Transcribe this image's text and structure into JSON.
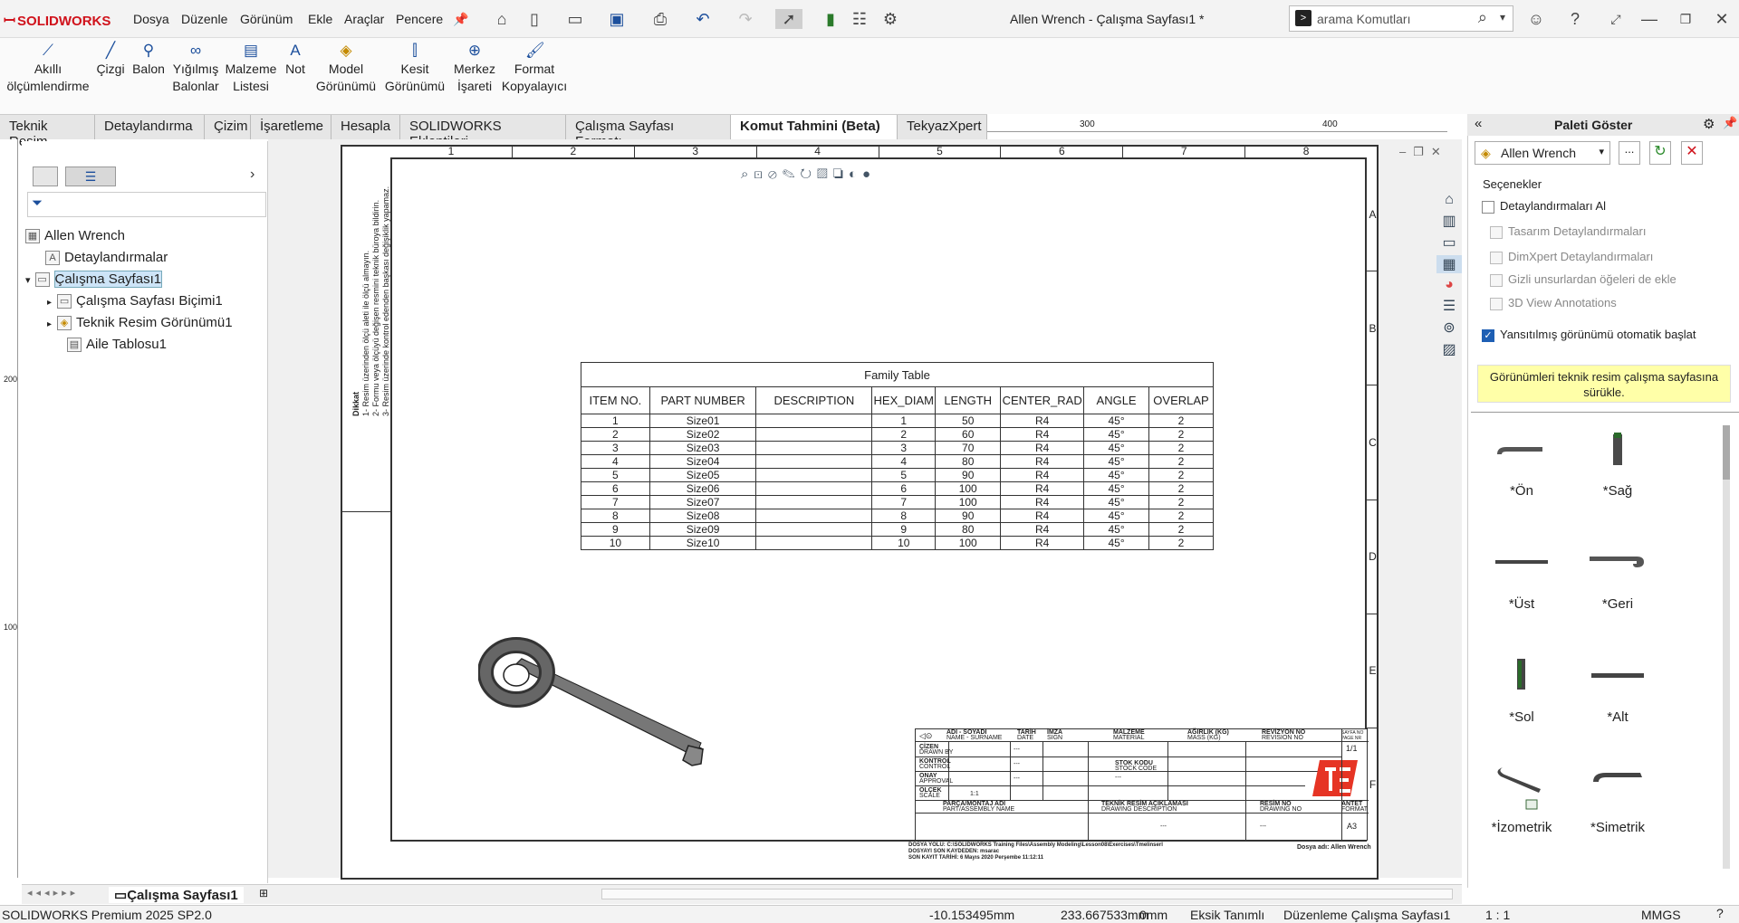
{
  "app": {
    "logo": "SOLIDWORKS",
    "window_title": "Allen Wrench - Çalışma Sayfası1 *",
    "menu": [
      "Dosya",
      "Düzenle",
      "Görünüm",
      "Ekle",
      "Araçlar",
      "Pencere"
    ],
    "search_placeholder": "arama Komutları"
  },
  "ribbon": {
    "buttons": [
      {
        "label1": "Akıllı",
        "label2": "ölçümlendirme",
        "icon": "smart-dimension-icon"
      },
      {
        "label1": "Çizgi",
        "label2": "",
        "icon": "line-icon"
      },
      {
        "label1": "Balon",
        "label2": "",
        "icon": "balloon-icon"
      },
      {
        "label1": "Yığılmış",
        "label2": "Balonlar",
        "icon": "stacked-balloon-icon"
      },
      {
        "label1": "Malzeme",
        "label2": "Listesi",
        "icon": "bom-icon"
      },
      {
        "label1": "Not",
        "label2": "",
        "icon": "note-icon"
      },
      {
        "label1": "Model",
        "label2": "Görünümü",
        "icon": "model-view-icon"
      },
      {
        "label1": "Kesit",
        "label2": "Görünümü",
        "icon": "section-view-icon"
      },
      {
        "label1": "Merkez",
        "label2": "İşareti",
        "icon": "center-mark-icon"
      },
      {
        "label1": "Format",
        "label2": "Kopyalayıcı",
        "icon": "format-painter-icon"
      }
    ]
  },
  "tabs": [
    "Teknik Resim",
    "Detaylandırma",
    "Çizim",
    "İşaretleme",
    "Hesapla",
    "SOLIDWORKS Eklentileri",
    "Çalışma Sayfası Formatı",
    "Komut Tahmini (Beta)",
    "TekyazXpert"
  ],
  "active_tab": "Komut Tahmini (Beta)",
  "ruler": {
    "h1": "300",
    "h2": "400",
    "v1": "200",
    "v2": "100"
  },
  "tree": {
    "root": "Allen Wrench",
    "items": [
      {
        "label": "Detaylandırmalar",
        "indent": 1
      },
      {
        "label": "Çalışma Sayfası1",
        "indent": 1
      },
      {
        "label": "Çalışma Sayfası Biçimi1",
        "indent": 2
      },
      {
        "label": "Teknik Resim Görünümü1",
        "indent": 2
      },
      {
        "label": "Aile Tablosu1",
        "indent": 2
      }
    ]
  },
  "sheet": {
    "col_labels": [
      "1",
      "2",
      "3",
      "4",
      "5",
      "6",
      "7",
      "8"
    ],
    "row_labels": [
      "A",
      "B",
      "C",
      "D",
      "E",
      "F"
    ],
    "notes_title": "Dikkat",
    "notes": [
      "1- Resim üzerinden ölçü aleti ile ölçü almayın.",
      "2- Formu veya ölçüyü değişen resmini teknik büroya bildirin.",
      "3- Resim üzerinde kontrol edenden başkası değişiklik yapamaz."
    ]
  },
  "family_table": {
    "title": "Family Table",
    "headers": [
      "ITEM NO.",
      "PART NUMBER",
      "DESCRIPTION",
      "HEX_DIAM",
      "LENGTH",
      "CENTER_RAD",
      "ANGLE",
      "OVERLAP"
    ],
    "rows": [
      [
        "1",
        "Size01",
        "",
        "1",
        "50",
        "R4",
        "45°",
        "2"
      ],
      [
        "2",
        "Size02",
        "",
        "2",
        "60",
        "R4",
        "45°",
        "2"
      ],
      [
        "3",
        "Size03",
        "",
        "3",
        "70",
        "R4",
        "45°",
        "2"
      ],
      [
        "4",
        "Size04",
        "",
        "4",
        "80",
        "R4",
        "45°",
        "2"
      ],
      [
        "5",
        "Size05",
        "",
        "5",
        "90",
        "R4",
        "45°",
        "2"
      ],
      [
        "6",
        "Size06",
        "",
        "6",
        "100",
        "R4",
        "45°",
        "2"
      ],
      [
        "7",
        "Size07",
        "",
        "7",
        "100",
        "R4",
        "45°",
        "2"
      ],
      [
        "8",
        "Size08",
        "",
        "8",
        "90",
        "R4",
        "45°",
        "2"
      ],
      [
        "9",
        "Size09",
        "",
        "9",
        "80",
        "R4",
        "45°",
        "2"
      ],
      [
        "10",
        "Size10",
        "",
        "10",
        "100",
        "R4",
        "45°",
        "2"
      ]
    ]
  },
  "title_block": {
    "h_name": "ADI - SOYADI",
    "h_name_en": "NAME - SURNAME",
    "h_date": "TARİH",
    "h_date_en": "DATE",
    "h_sign": "İMZA",
    "h_sign_en": "SIGN",
    "h_material": "MALZEME",
    "h_material_en": "MATERIAL",
    "h_mass": "AĞIRLIK (KG)",
    "h_mass_en": "MASS (KG)",
    "h_rev": "REVİZYON NO",
    "h_rev_en": "REVISION NO",
    "h_page": "SAYFA NO",
    "h_page_en": "PAGE NR",
    "page_val": "1/1",
    "r_drawn": "ÇİZEN",
    "r_drawn_en": "DRAWN BY",
    "r_control": "KONTROL",
    "r_control_en": "CONTROL",
    "r_approval": "ONAY",
    "r_approval_en": "APPROVAL",
    "r_scale": "ÖLÇEK",
    "r_scale_en": "SCALE",
    "scale_val": "1:1",
    "stock": "STOK KODU",
    "stock_en": "STOCK CODE",
    "dash": "---",
    "part_name": "PARÇA/MONTAJ ADI",
    "part_name_en": "PART/ASSEMBLY NAME",
    "drawing_desc": "TEKNİK RESİM AÇIKLAMASI",
    "drawing_desc_en": "DRAWING DESCRIPTION",
    "drawing_no": "RESİM NO",
    "drawing_no_en": "DRAWING NO",
    "format": "ANTET",
    "format_en": "FORMAT",
    "format_val": "A3",
    "path": "DOSYA YOLU: C:\\SOLIDWORKS Training Files\\Assembly Modeling\\Lesson08\\Exercises\\Tmelinserl",
    "last_saved_by": "DOSYAYI SON KAYDEDEN: msarac",
    "last_saved": "SON KAYIT TARİHİ: 6 Mayıs 2020 Perşembe 11:12:11",
    "filename": "Dosya adı: Allen Wrench"
  },
  "palette": {
    "title": "Paleti Göster",
    "model": "Allen Wrench",
    "browse": "...",
    "options_title": "Seçenekler",
    "opt_import": "Detaylandırmaları Al",
    "opt_design": "Tasarım Detaylandırmaları",
    "opt_dimxpert": "DimXpert Detaylandırmaları",
    "opt_hidden": "Gizli unsurlardan öğeleri de ekle",
    "opt_3d": "3D View Annotations",
    "opt_auto": "Yansıtılmış görünümü otomatik başlat",
    "hint": "Görünümleri teknik resim çalışma sayfasına sürükle.",
    "views": [
      "*Ön",
      "*Sağ",
      "*Üst",
      "*Geri",
      "*Sol",
      "*Alt",
      "*İzometrik",
      "*Simetrik"
    ]
  },
  "bottom_tab": "Çalışma Sayfası1",
  "status": {
    "product": "SOLIDWORKS Premium 2025 SP2.0",
    "x": "-10.153495mm",
    "y": "233.667533mm",
    "z": "0mm",
    "defined": "Eksik Tanımlı",
    "editing": "Düzenleme Çalışma Sayfası1",
    "scale": "1 : 1",
    "units": "MMGS"
  }
}
